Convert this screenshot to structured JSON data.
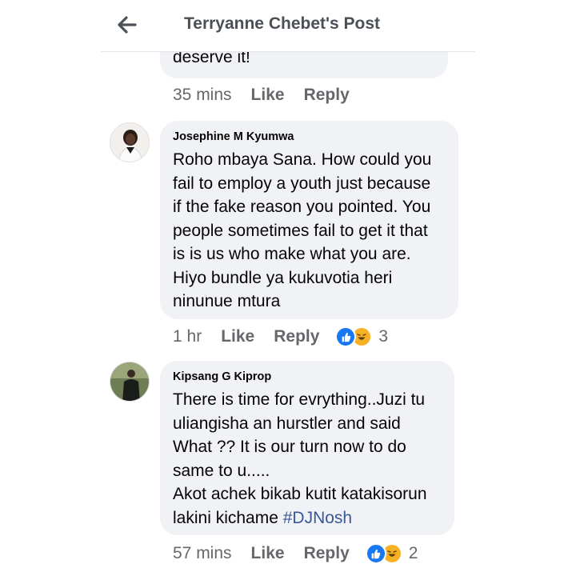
{
  "header": {
    "title": "Terryanne Chebet's Post"
  },
  "comments": [
    {
      "text": "deserve it!",
      "time": "35 mins",
      "like": "Like",
      "reply": "Reply"
    },
    {
      "author": "Josephine M Kyumwa",
      "text": "Roho mbaya Sana. How could you\nfail to employ a youth just because\nif the fake reason you pointed. You\npeople sometimes fail to get it that\nis is us who make what you are.\nHiyo bundle ya kukuvotia heri\nninunue mtura",
      "time": "1 hr",
      "like": "Like",
      "reply": "Reply",
      "reaction_count": "3"
    },
    {
      "author": "Kipsang G Kiprop",
      "text": "There is time for evrything..Juzi tu\nuliangisha an hurstler  and said\nWhat ?? It is our turn now to do\nsame to u.....\nAkot achek bikab kutit katakisorun\nlakini kichame ",
      "hashtag": "#DJNosh",
      "time": "57 mins",
      "like": "Like",
      "reply": "Reply",
      "reaction_count": "2"
    }
  ],
  "colors": {
    "bubble": "#f0f2f5",
    "like_blue": "#1877f2",
    "haha_yellow": "#f7b125",
    "hashtag": "#385898",
    "meta_gray": "#65676b"
  },
  "icons": [
    "back-arrow-icon",
    "like-reaction-icon",
    "haha-reaction-icon"
  ]
}
